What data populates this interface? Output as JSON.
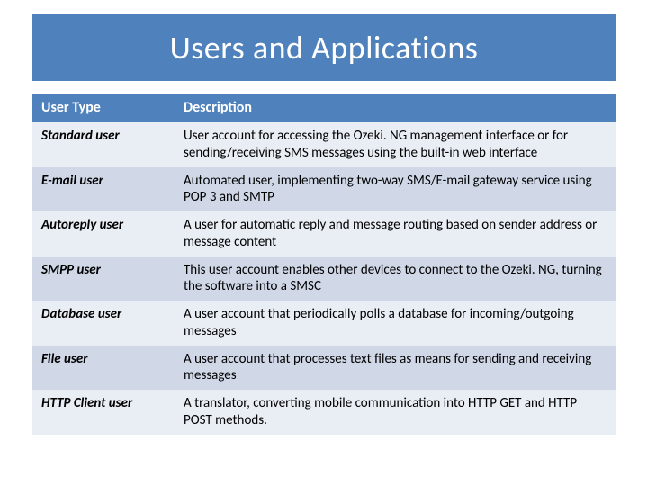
{
  "title": "Users and Applications",
  "table": {
    "headers": {
      "type": "User Type",
      "desc": "Description"
    },
    "rows": [
      {
        "type": "Standard user",
        "desc": "User account for accessing the Ozeki. NG management interface or for sending/receiving SMS messages using the built-in web interface"
      },
      {
        "type": "E-mail user",
        "desc": "Automated user, implementing two-way SMS/E-mail gateway service using POP 3 and SMTP"
      },
      {
        "type": "Autoreply user",
        "desc": "A user for automatic reply and message routing based on sender address or message content"
      },
      {
        "type": "SMPP user",
        "desc": "This user account enables other devices to connect to the Ozeki. NG, turning the software into a SMSC"
      },
      {
        "type": "Database user",
        "desc": "A user account that periodically polls a database for incoming/outgoing messages"
      },
      {
        "type": "File user",
        "desc": "A user account that processes text files as means for sending and receiving messages"
      },
      {
        "type": "HTTP Client user",
        "desc": "A translator, converting mobile communication into HTTP GET and HTTP POST methods."
      }
    ]
  }
}
